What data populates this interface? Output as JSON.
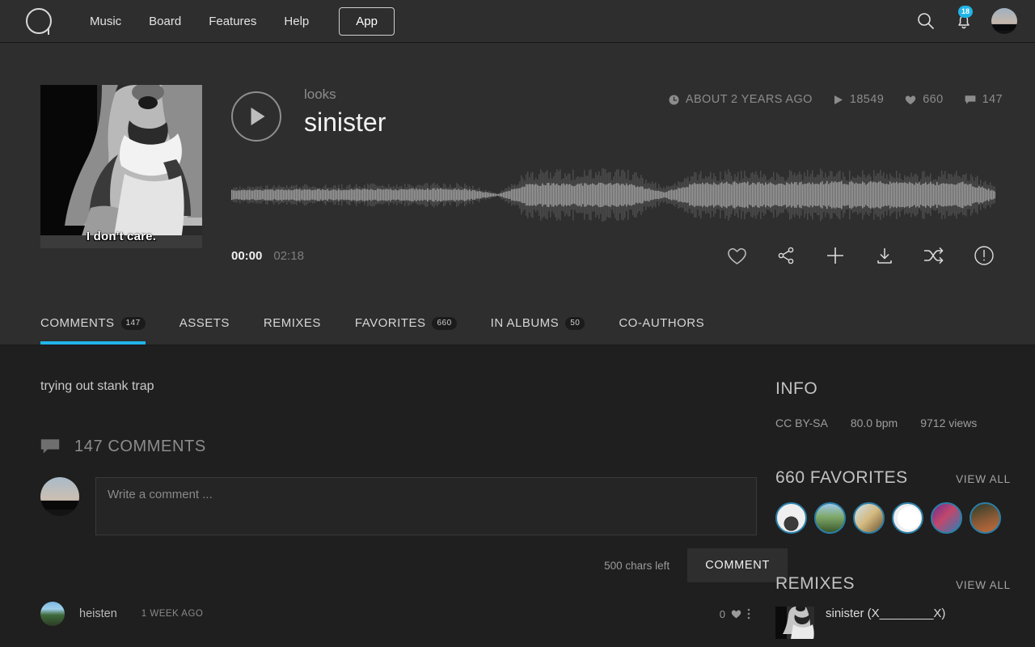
{
  "nav": {
    "logo_name": "logo-icon",
    "links": [
      "Music",
      "Board",
      "Features",
      "Help"
    ],
    "app_button": "App",
    "search_icon": "search-icon",
    "bell_icon": "bell-icon",
    "notification_count": "18",
    "avatar": "user-avatar"
  },
  "track": {
    "artist": "looks",
    "title": "sinister",
    "cover_caption": "I don't care.",
    "time_current": "00:00",
    "duration": "02:18",
    "stats": {
      "age": "ABOUT 2 YEARS AGO",
      "plays": "18549",
      "likes": "660",
      "comments": "147"
    },
    "actions": [
      "heart-icon",
      "share-icon",
      "add-icon",
      "download-icon",
      "remix-icon",
      "report-icon"
    ]
  },
  "tabs": [
    {
      "label": "COMMENTS",
      "badge": "147",
      "active": true
    },
    {
      "label": "ASSETS",
      "badge": "",
      "active": false
    },
    {
      "label": "REMIXES",
      "badge": "",
      "active": false
    },
    {
      "label": "FAVORITES",
      "badge": "660",
      "active": false
    },
    {
      "label": "IN ALBUMS",
      "badge": "50",
      "active": false
    },
    {
      "label": "CO-AUTHORS",
      "badge": "",
      "active": false
    }
  ],
  "main": {
    "description": "trying out stank trap",
    "comments_heading": "147 COMMENTS",
    "comment_placeholder": "Write a comment ...",
    "comment_value": "",
    "chars_left": "500 chars left",
    "comment_button": "COMMENT",
    "comments": [
      {
        "user": "heisten",
        "time": "1 WEEK AGO",
        "likes": "0"
      }
    ]
  },
  "sidebar": {
    "info_heading": "INFO",
    "license": "CC BY-SA",
    "bpm": "80.0 bpm",
    "views": "9712 views",
    "favorites_heading": "660 FAVORITES",
    "favorites_view_all": "VIEW ALL",
    "remixes_heading": "REMIXES",
    "remixes_view_all": "VIEW ALL",
    "remix_items": [
      {
        "title": "sinister (X________X)"
      }
    ]
  },
  "colors": {
    "accent": "#21b4e8",
    "bg_dark": "#1f1f1f",
    "bg_panel": "#2e2e2e"
  }
}
